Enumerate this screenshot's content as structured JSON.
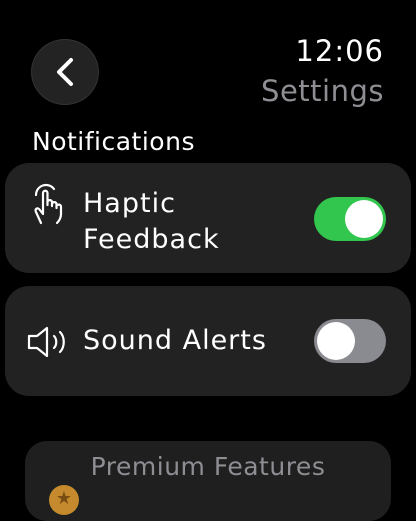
{
  "header": {
    "time": "12:06",
    "title": "Settings",
    "back_icon": "chevron-left-icon"
  },
  "section": {
    "heading": "Notifications"
  },
  "settings": {
    "haptic": {
      "label": "Haptic Feedback",
      "icon": "tap-hand-icon",
      "enabled": true
    },
    "sound": {
      "label": "Sound Alerts",
      "icon": "speaker-icon",
      "enabled": false
    }
  },
  "premium": {
    "label": "Premium Features",
    "icon": "star-badge-icon"
  },
  "colors": {
    "toggle_on": "#32c64f",
    "toggle_off": "#8a8a91",
    "card_background": "#222222",
    "secondary_text": "#8e8e93",
    "premium_badge": "#c58a2e"
  }
}
